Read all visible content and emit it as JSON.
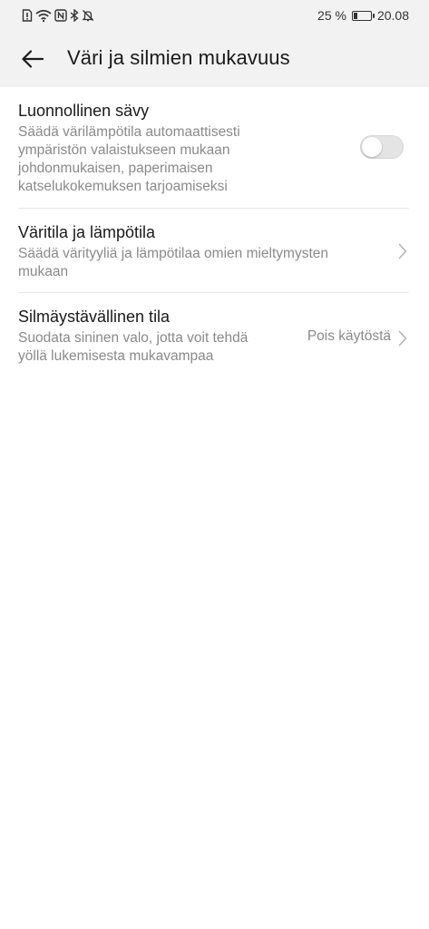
{
  "status_bar": {
    "battery_percent_text": "25 %",
    "battery_level": 0.25,
    "time": "20.08",
    "icons": [
      "sim-icon",
      "wifi-icon",
      "nfc-icon",
      "bluetooth-icon",
      "mute-icon"
    ]
  },
  "header": {
    "back_icon": "arrow-left-icon",
    "title": "Väri ja silmien mukavuus",
    "background": "#f2f2f2"
  },
  "settings": [
    {
      "title": "Luonnollinen sävy",
      "subtitle_lines": [
        "Säädä värilämpötila automaattisesti",
        "ympäristön valaistukseen mukaan",
        "johdonmukaisen, paperimaisen",
        "katselukokemuksen tarjoamiseksi"
      ],
      "toggle_on": false
    },
    {
      "title": "Väritila ja lämpötila",
      "subtitle_lines": [
        "Säädä värityyliä ja lämpötilaa omien mieltymysten",
        "mukaan"
      ]
    },
    {
      "title": "Silmäystävällinen tila",
      "subtitle_lines": [
        "Suodata sininen valo, jotta voit tehdä",
        "yöllä lukemisesta mukavampaa"
      ],
      "value": "Pois käytöstä"
    }
  ]
}
